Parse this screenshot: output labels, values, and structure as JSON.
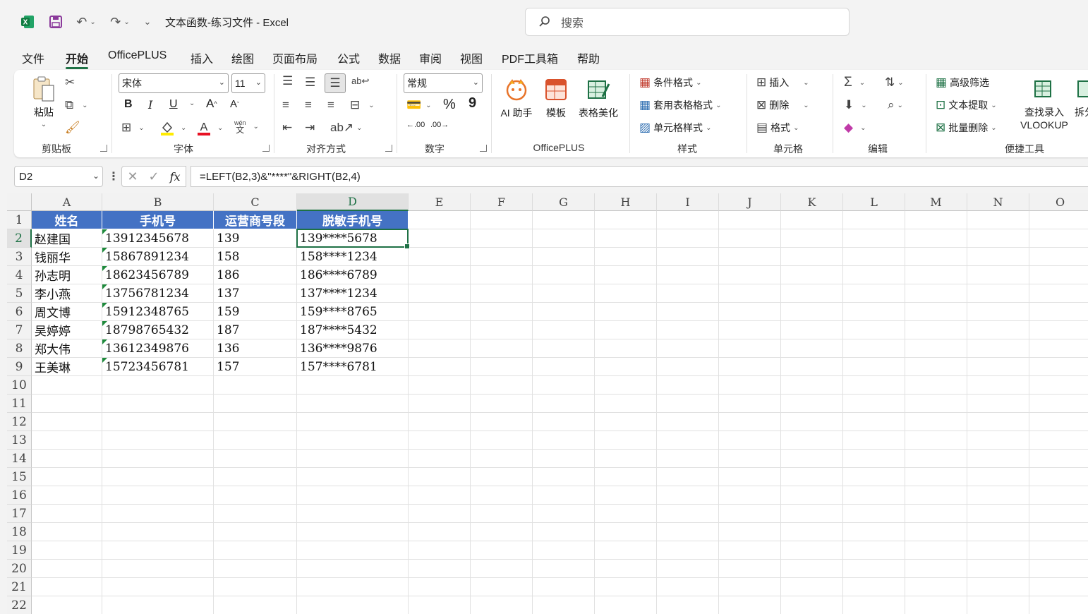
{
  "window": {
    "title": "文本函数-练习文件  -  Excel"
  },
  "search": {
    "placeholder": "搜索"
  },
  "menu": {
    "tabs": [
      "文件",
      "开始",
      "OfficePLUS",
      "插入",
      "绘图",
      "页面布局",
      "公式",
      "数据",
      "审阅",
      "视图",
      "PDF工具箱",
      "帮助"
    ],
    "active": "开始"
  },
  "ribbon": {
    "clipboard": {
      "label": "剪贴板",
      "paste": "粘贴"
    },
    "font": {
      "label": "字体",
      "name": "宋体",
      "size": "11",
      "bold": "B",
      "italic": "I",
      "underline": "U",
      "grow": "A",
      "shrink": "A",
      "phonetic": "wén"
    },
    "alignment": {
      "label": "对齐方式"
    },
    "number": {
      "label": "数字",
      "format": "常规",
      "percent": "%",
      "comma": "9",
      "inc": ".00",
      "dec": ".00"
    },
    "officeplus": {
      "label": "OfficePLUS",
      "ai": "AI 助手",
      "template": "模板",
      "beautify": "表格美化"
    },
    "styles": {
      "label": "样式",
      "conditional": "条件格式",
      "table": "套用表格格式",
      "cell": "单元格样式"
    },
    "cells": {
      "label": "单元格",
      "insert": "插入",
      "delete": "删除",
      "format": "格式"
    },
    "editing": {
      "label": "编辑"
    },
    "quick": {
      "label": "便捷工具",
      "filter": "高级筛选",
      "extract": "文本提取",
      "batch": "批量删除",
      "vlookup_line1": "查找录入",
      "vlookup_line2": "VLOOKUP",
      "split": "拆分"
    }
  },
  "formula_bar": {
    "name_box": "D2",
    "fx": "fx",
    "formula": "=LEFT(B2,3)&\"****\"&RIGHT(B2,4)"
  },
  "sheet": {
    "columns": [
      "A",
      "B",
      "C",
      "D",
      "E",
      "F",
      "G",
      "H",
      "I",
      "J",
      "K",
      "L",
      "M",
      "N",
      "O"
    ],
    "rows": [
      "1",
      "2",
      "3",
      "4",
      "5",
      "6",
      "7",
      "8",
      "9",
      "10",
      "11",
      "12",
      "13",
      "14",
      "15",
      "16",
      "17",
      "18",
      "19",
      "20",
      "21",
      "22"
    ],
    "selected_cell": "D2",
    "headers": [
      "姓名",
      "手机号",
      "运营商号段",
      "脱敏手机号"
    ],
    "data": [
      [
        "赵建国",
        "13912345678",
        "139",
        "139****5678"
      ],
      [
        "钱丽华",
        "15867891234",
        "158",
        "158****1234"
      ],
      [
        "孙志明",
        "18623456789",
        "186",
        "186****6789"
      ],
      [
        "李小燕",
        "13756781234",
        "137",
        "137****1234"
      ],
      [
        "周文博",
        "15912348765",
        "159",
        "159****8765"
      ],
      [
        "吴婷婷",
        "18798765432",
        "187",
        "187****5432"
      ],
      [
        "郑大伟",
        "13612349876",
        "136",
        "136****9876"
      ],
      [
        "王美琳",
        "15723456781",
        "157",
        "157****6781"
      ]
    ]
  },
  "colors": {
    "accent": "#1e7145",
    "header_fill": "#4472c4",
    "text_marker": "#1e8a3c"
  }
}
